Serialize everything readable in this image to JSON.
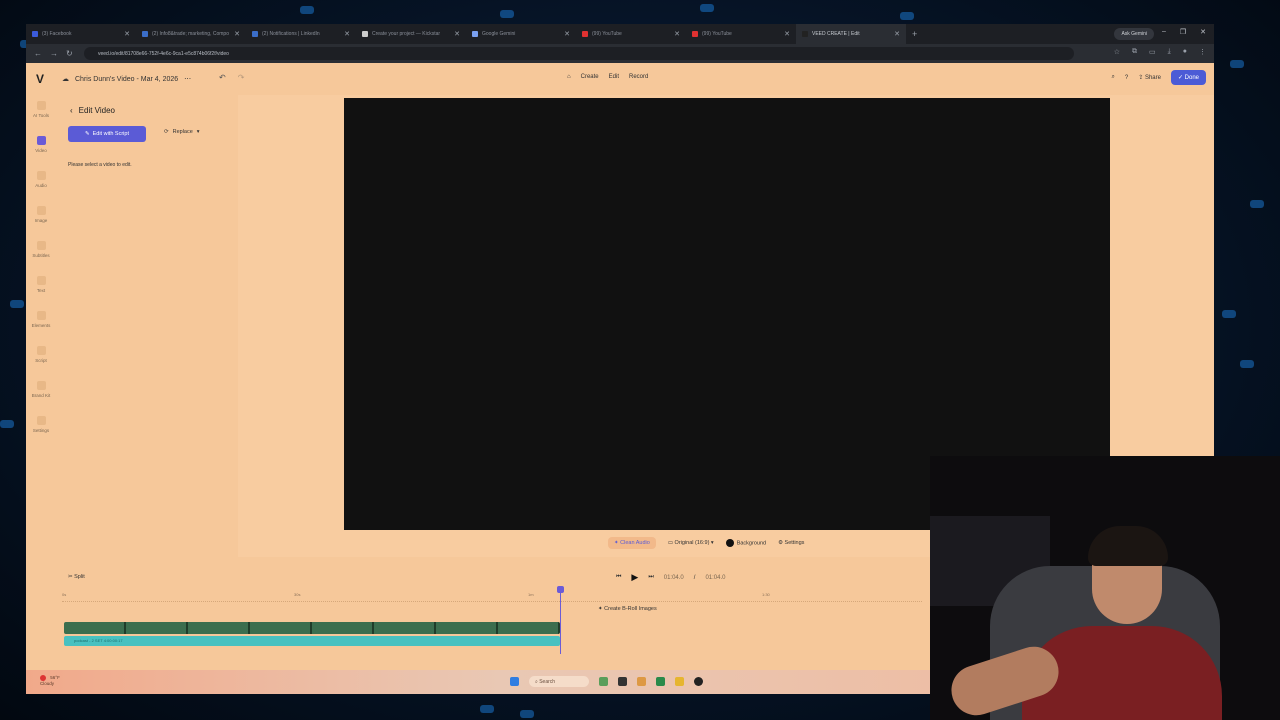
{
  "browser": {
    "tabs": [
      {
        "label": "(3) Facebook",
        "color": "#3b5bdb"
      },
      {
        "label": "(2) Info8&trade; marketing, Compo",
        "color": "#3b6ec9"
      },
      {
        "label": "(2) Notifications | LinkedIn",
        "color": "#3b6ec9"
      },
      {
        "label": "Create your project — Kickstar",
        "color": "#cccccc"
      },
      {
        "label": "Google Gemini",
        "color": "#7aa0f0"
      },
      {
        "label": "(99) YouTube",
        "color": "#e03131"
      },
      {
        "label": "(99) YouTube",
        "color": "#e03131"
      },
      {
        "label": "VEED CREATE | Edit",
        "color": "#222222"
      }
    ],
    "ask_gemini": "Ask Gemini",
    "url": "veed.io/edit/81708e66-752f-4e6c-9ca1-e5c874b06f2f/video"
  },
  "app": {
    "logo": "V",
    "project_title": "Chris Dunn's Video - Mar 4, 2026",
    "nav": {
      "create": "Create",
      "edit": "Edit",
      "record": "Record"
    },
    "share": "Share",
    "done": "Done"
  },
  "rail": [
    {
      "label": "AI Tools"
    },
    {
      "label": "Video"
    },
    {
      "label": "Audio"
    },
    {
      "label": "Image"
    },
    {
      "label": "Subtitles"
    },
    {
      "label": "Text"
    },
    {
      "label": "Elements"
    },
    {
      "label": "Script"
    },
    {
      "label": "Brand Kit"
    },
    {
      "label": "Settings"
    }
  ],
  "panel": {
    "title": "Edit Video",
    "edit_with_script": "Edit with Script",
    "replace": "Replace",
    "hint": "Please select a video to edit."
  },
  "video_tools": {
    "clean_audio": "Clean Audio",
    "ratio": "Original (16:9)",
    "background": "Background",
    "settings": "Settings"
  },
  "timeline": {
    "split": "Split",
    "time_current": "01:04.0",
    "time_separator": "/",
    "time_total": "01:04.0",
    "broll": "Create B-Roll Images",
    "audio_label": "podcast - 2 SET 4:00:00:17",
    "ticks": [
      "0s",
      "30s",
      "1m",
      "1:30"
    ]
  },
  "taskbar": {
    "weather_temp": "56°F",
    "weather_desc": "Cloudy",
    "search": "Search"
  },
  "colors": {
    "accent": "#5b5bd6",
    "app_bg": "#f6c89a",
    "video_bg": "#111111"
  }
}
